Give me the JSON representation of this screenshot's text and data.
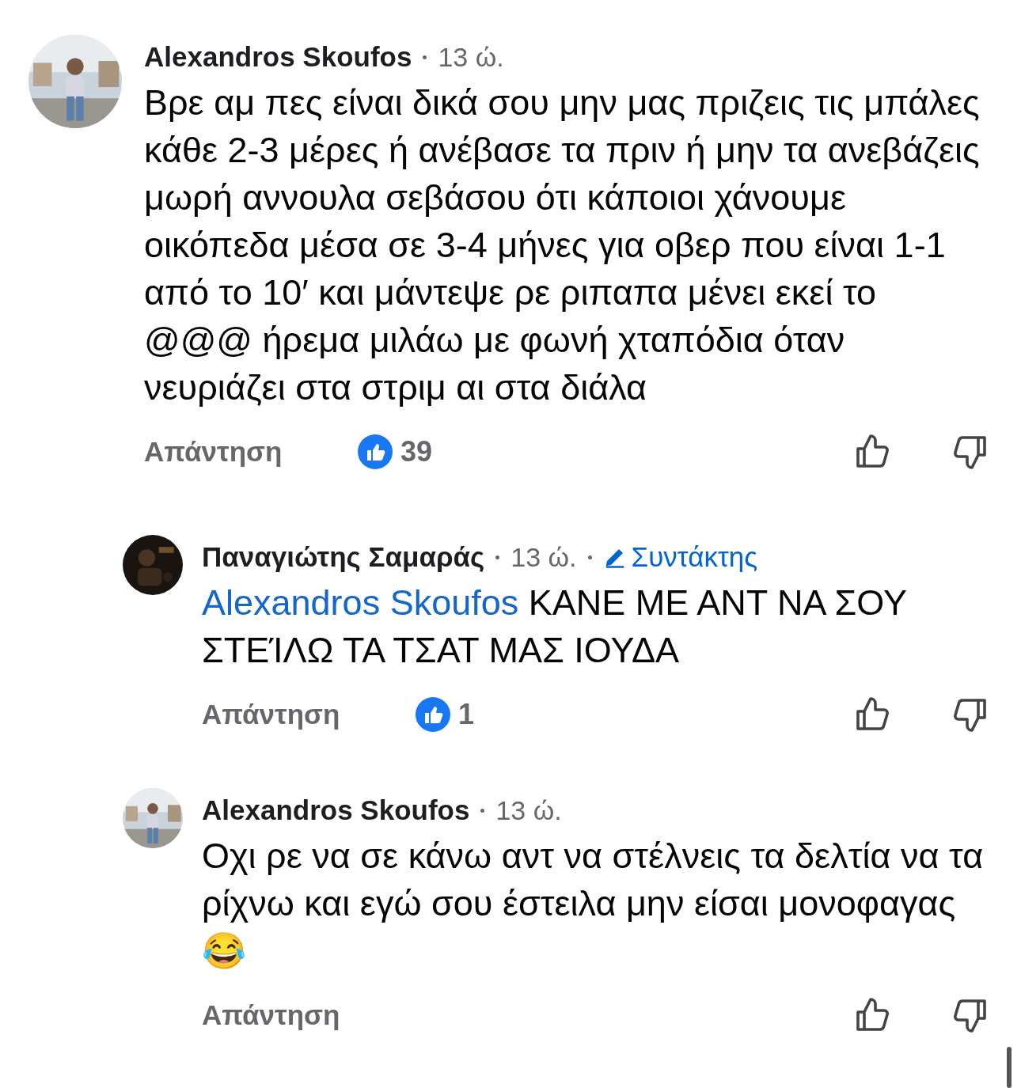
{
  "comments": [
    {
      "author": "Alexandros Skoufos",
      "time": "13 ώ.",
      "text": "Βρε αμ πες είναι δικά σου μην μας πριζεις τις μπάλες κάθε 2-3 μέρες ή ανέβασε τα πριν ή μην τα ανεβάζεις μωρή αννουλα σεβάσου ότι κάποιοι χάνουμε οικόπεδα μέσα σε 3-4 μήνες για οβερ που είναι 1-1 από το 10′ και μάντεψε ρε ριπαπα μένει εκεί το @@@ ήρεμα μιλάω με φωνή χταπόδια όταν νευριάζει στα στριμ αι στα διάλα",
      "reply_label": "Απάντηση",
      "like_count": "39",
      "children": [
        {
          "author": "Παναγιώτης Σαμαράς",
          "time": "13 ώ.",
          "badge": "Συντάκτης",
          "mention": "Alexandros Skoufos",
          "text": "ΚΑΝΕ ΜΕ ΑΝΤ ΝΑ ΣΟΥ ΣΤΕΊΛΩ ΤΑ ΤΣΑΤ ΜΑΣ ΙΟΥΔΑ",
          "reply_label": "Απάντηση",
          "like_count": "1"
        },
        {
          "author": "Alexandros Skoufos",
          "time": "13 ώ.",
          "text": "Οχι ρε να σε κάνω αντ να στέλνεις τα δελτία να τα ρίχνω και εγώ σου έστειλα μην είσαι μονοφαγας 😂",
          "reply_label": "Απάντηση"
        }
      ]
    }
  ]
}
